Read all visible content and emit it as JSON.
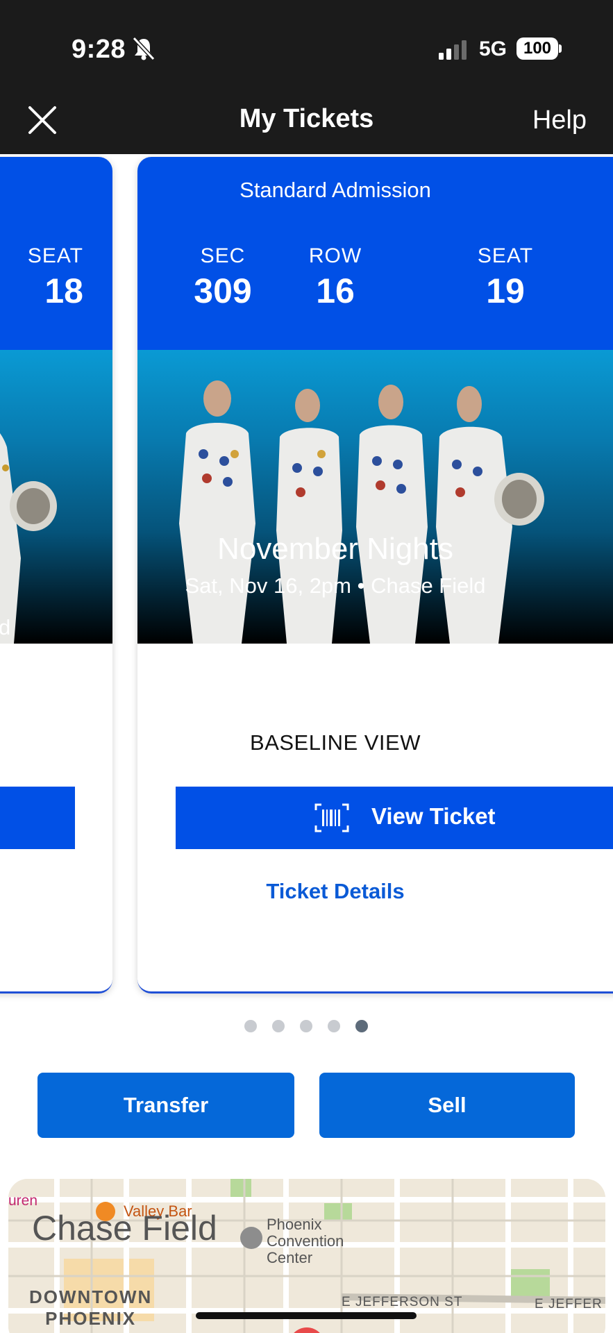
{
  "status_bar": {
    "time": "9:28",
    "network": "5G",
    "battery": "100"
  },
  "header": {
    "title": "My Tickets",
    "help_label": "Help"
  },
  "left_card": {
    "seat_label": "SEAT",
    "seat_value": "18",
    "event_fragment": "d"
  },
  "ticket": {
    "admission": "Standard Admission",
    "sec_label": "SEC",
    "sec_value": "309",
    "row_label": "ROW",
    "row_value": "16",
    "seat_label": "SEAT",
    "seat_value": "19",
    "event_name": "November Nights",
    "event_info": "Sat, Nov 16, 2pm • Chase Field",
    "view_type": "BASELINE VIEW",
    "view_ticket_label": "View Ticket",
    "details_label": "Ticket Details"
  },
  "pager": {
    "count": 5,
    "active_index": 4
  },
  "actions": {
    "transfer_label": "Transfer",
    "sell_label": "Sell"
  },
  "map": {
    "venue_label": "Chase Field",
    "poi_bar": "Valley Bar",
    "poi_convention": "Phoenix\nConvention\nCenter",
    "poi_partial": "uren",
    "district_line1": "DOWNTOWN",
    "district_line2": "PHOENIX",
    "street1": "E JEFFERSON ST",
    "street2": "E JEFFER"
  },
  "colors": {
    "primary_blue": "#0150e6",
    "action_blue": "#0568d9",
    "link_blue": "#0a5ad6"
  }
}
